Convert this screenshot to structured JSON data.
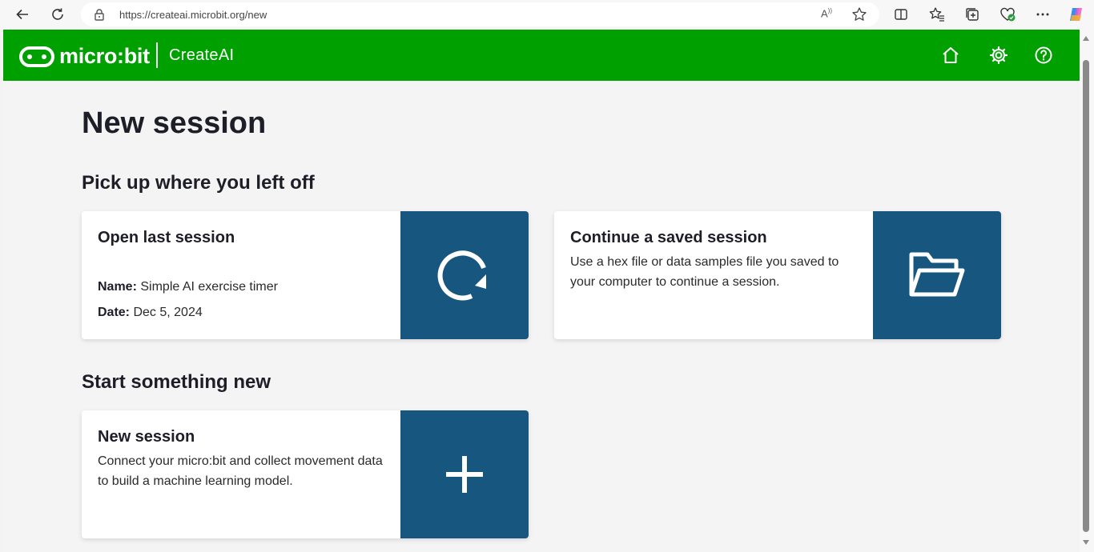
{
  "browser": {
    "url": "https://createai.microbit.org/new",
    "reader_icon": "read-aloud-icon"
  },
  "header": {
    "logo_text": "micro:bit",
    "product_name": "CreateAI",
    "brand_color": "#00a000"
  },
  "page": {
    "title": "New session",
    "section_resume": "Pick up where you left off",
    "section_new": "Start something new"
  },
  "cards": {
    "open_last": {
      "title": "Open last session",
      "name_label": "Name:",
      "name_value": "Simple AI exercise timer",
      "date_label": "Date:",
      "date_value": "Dec 5, 2024",
      "icon": "refresh-icon"
    },
    "continue_saved": {
      "title": "Continue a saved session",
      "description": "Use a hex file or data samples file you saved to your computer to continue a session.",
      "icon": "folder-open-icon"
    },
    "new_session": {
      "title": "New session",
      "description": "Connect your micro:bit and collect movement data to build a machine learning model.",
      "icon": "plus-icon"
    },
    "panel_color": "#17577f"
  }
}
